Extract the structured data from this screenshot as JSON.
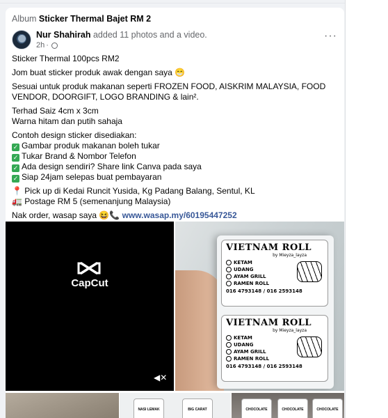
{
  "album": {
    "prefix": "Album",
    "name": "Sticker Thermal Bajet RM 2"
  },
  "post": {
    "author": "Nur Shahirah",
    "action": "added 11 photos and a video.",
    "time": "2h",
    "more_label": "···",
    "lines": [
      "Sticker Thermal 100pcs RM2",
      "Jom buat sticker produk awak dengan saya 😁",
      "Sesuai untuk produk makanan seperti FROZEN FOOD, AISKRIM MALAYSIA, FOOD VENDOR, DOORGIFT, LOGO BRANDING & lain².",
      "Terhad Saiz 4cm x 3cm",
      "Warna hitam dan putih sahaja",
      "Contoh design sticker disediakan:"
    ],
    "checklist": [
      "Gambar produk makanan boleh tukar",
      "Tukar Brand & Nombor Telefon",
      "Ada design sendiri? Share link Canva pada saya",
      "Siap 24jam selepas buat pembayaran"
    ],
    "pickup": "📍 Pick up di Kedai Runcit Yusida, Kg Padang Balang, Sentul, KL",
    "postage": "🚛 Postage RM 5 (semenanjung Malaysia)",
    "order_text": "Nak order, wasap saya 😆📞",
    "order_link": "www.wasap.my/60195447252"
  },
  "media": {
    "video_brand": "CapCut",
    "mute_icon": "mute-icon",
    "sticker": {
      "title": "VIETNAM ROLL",
      "byline": "by Mieyza_layza",
      "options": [
        "KETAM",
        "UDANG",
        "AYAM GRILL",
        "RAMEN ROLL"
      ],
      "phone": "016 4793148 / 016 2593148"
    },
    "thumb_labels": [
      "NASI LEMAK",
      "BIG CARAT",
      "CHOCOLATE"
    ]
  },
  "colors": {
    "link": "#385898",
    "check": "#34a853",
    "muted": "#65676b"
  }
}
